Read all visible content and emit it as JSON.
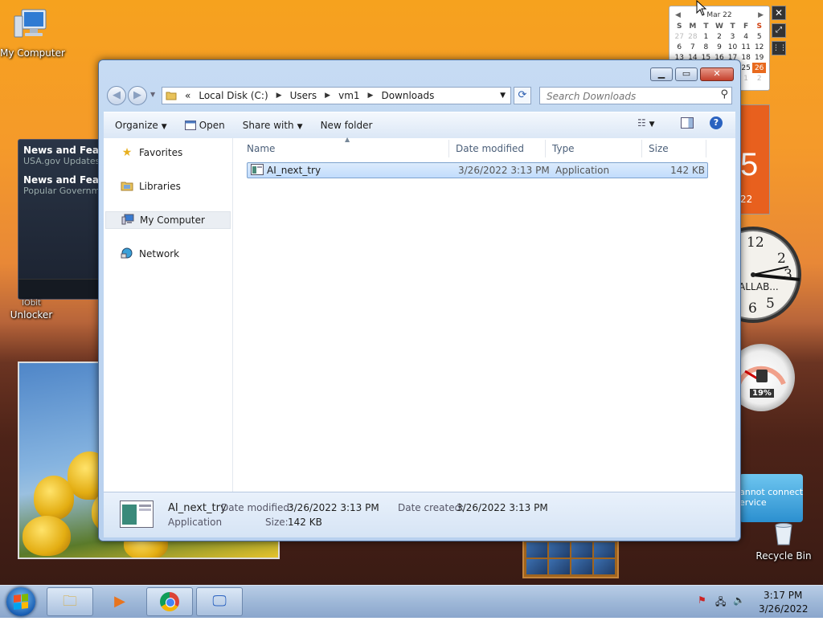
{
  "desktop": {
    "icons": {
      "my_computer": "My Computer",
      "iobit_line1": "IObit",
      "iobit_line2": "Unlocker",
      "recycle_bin": "Recycle Bin"
    }
  },
  "gadgets": {
    "news": [
      {
        "title": "News and Featu",
        "sub": "USA.gov Updates:"
      },
      {
        "title": "News and Featu",
        "sub": "Popular Governm"
      }
    ],
    "calendar": {
      "month": "Mar 22",
      "weekdays": [
        "S",
        "M",
        "T",
        "W",
        "T",
        "F",
        "S"
      ],
      "weeks": [
        [
          "27",
          "28",
          "1",
          "2",
          "3",
          "4",
          "5"
        ],
        [
          "6",
          "7",
          "8",
          "9",
          "10",
          "11",
          "12"
        ],
        [
          "13",
          "14",
          "15",
          "16",
          "17",
          "18",
          "19"
        ],
        [
          "20",
          "21",
          "22",
          "23",
          "24",
          "25",
          "26"
        ],
        [
          "27",
          "28",
          "29",
          "30",
          "31",
          "1",
          "2"
        ]
      ],
      "today": "26"
    },
    "orange_digit": "5",
    "orange_year": "22",
    "clock_label": "ALLAB...",
    "clock_numbers": [
      "12",
      "2",
      "3",
      "5",
      "6"
    ],
    "cpu_percent": "19%",
    "weather_line1": "annot connect",
    "weather_line2": "ervice"
  },
  "explorer": {
    "address": {
      "overflow": "«",
      "segments": [
        "Local Disk (C:)",
        "Users",
        "vm1",
        "Downloads"
      ]
    },
    "search_placeholder": "Search Downloads",
    "toolbar": {
      "organize": "Organize",
      "open": "Open",
      "share_with": "Share with",
      "new_folder": "New folder"
    },
    "nav": {
      "favorites": "Favorites",
      "libraries": "Libraries",
      "my_computer": "My Computer",
      "network": "Network"
    },
    "columns": {
      "name": "Name",
      "date_modified": "Date modified",
      "type": "Type",
      "size": "Size"
    },
    "files": [
      {
        "name": "AI_next_try",
        "date_modified": "3/26/2022 3:13 PM",
        "type": "Application",
        "size": "142 KB"
      }
    ],
    "details": {
      "name": "AI_next_try",
      "type": "Application",
      "date_modified_label": "Date modified:",
      "date_modified": "3/26/2022 3:13 PM",
      "size_label": "Size:",
      "size": "142 KB",
      "date_created_label": "Date created:",
      "date_created": "3/26/2022 3:13 PM"
    }
  },
  "taskbar": {
    "time": "3:17 PM",
    "date": "3/26/2022"
  }
}
